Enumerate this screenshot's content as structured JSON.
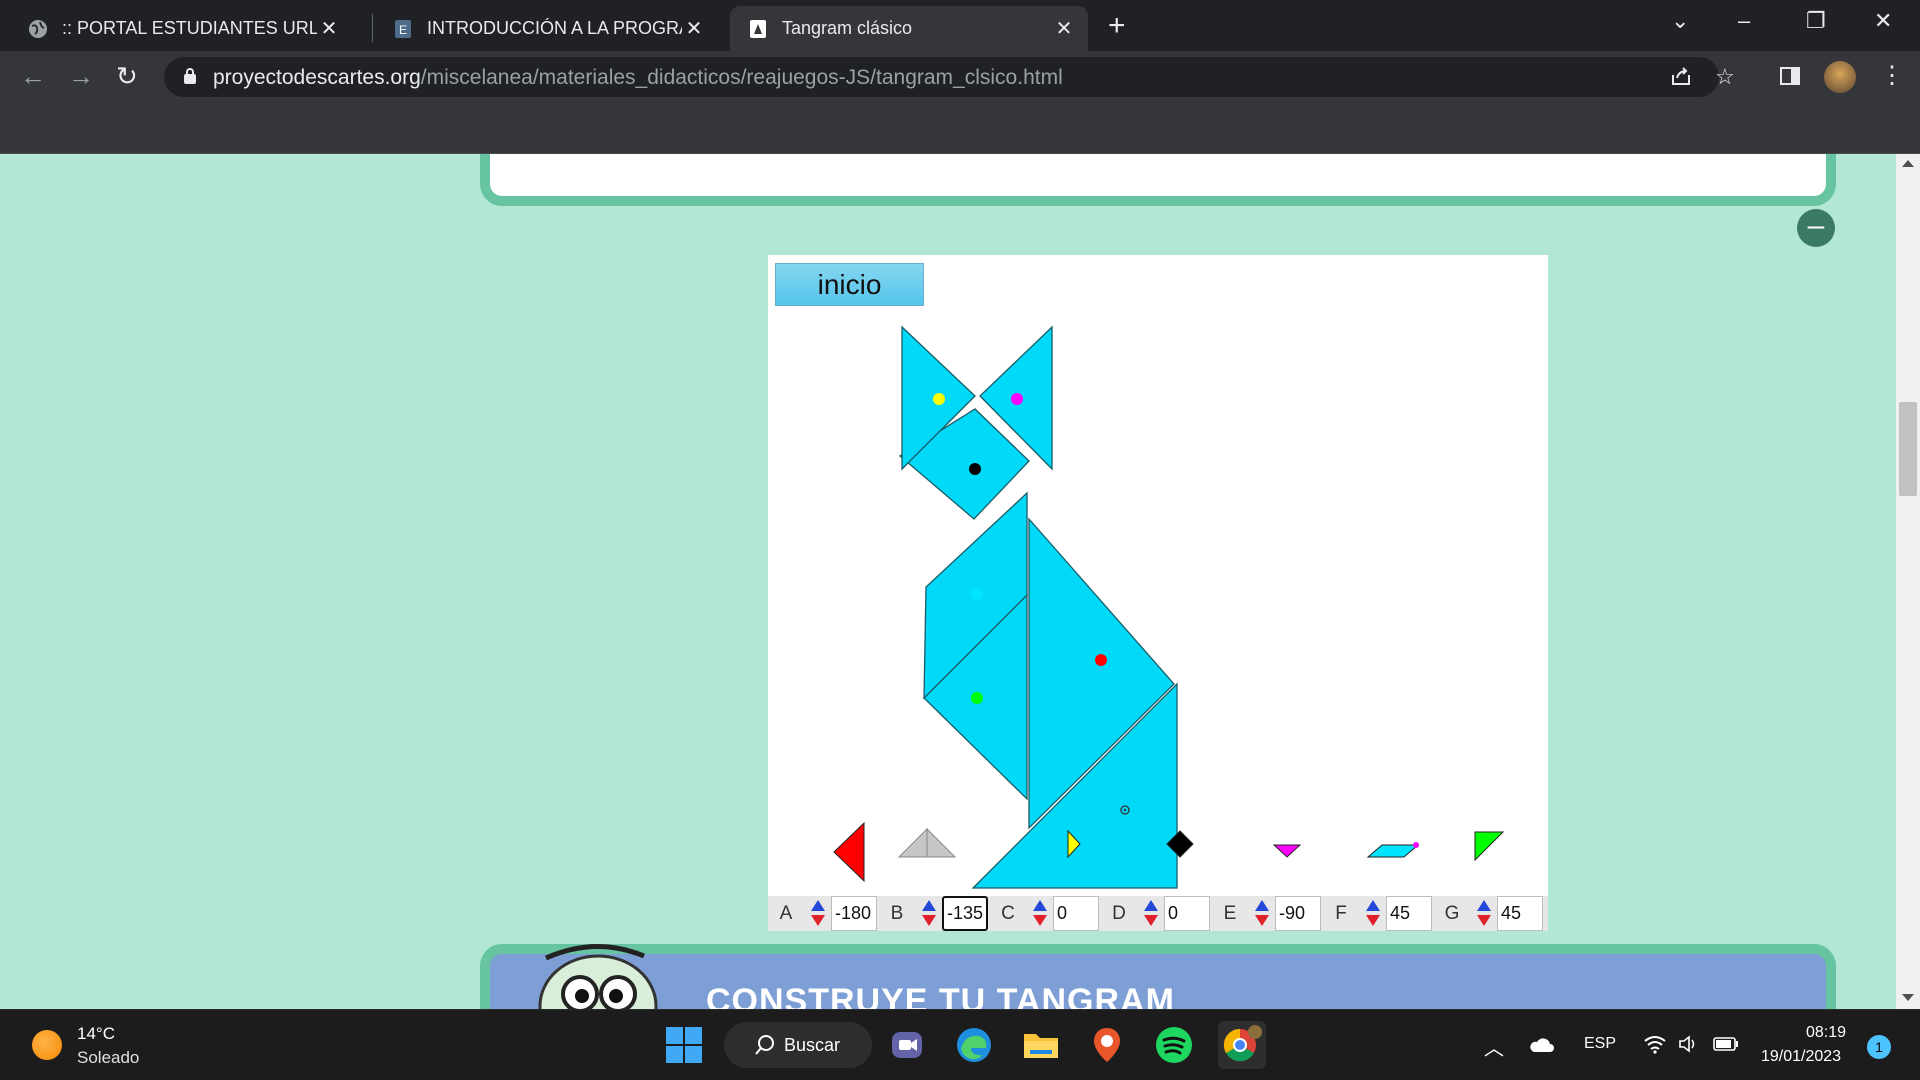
{
  "browser": {
    "tabs": [
      {
        "title": ":: PORTAL ESTUDIANTES URL ::",
        "active": false
      },
      {
        "title": "INTRODUCCIÓN A LA PROGRAMACIÓN",
        "active": false
      },
      {
        "title": "Tangram clásico",
        "active": true
      }
    ],
    "new_tab_label": "+",
    "url_host": "proyectodescartes.org",
    "url_path": "/miscelanea/materiales_didacticos/reajuegos-JS/tangram_clsico.html"
  },
  "scene": {
    "start_button": "inicio",
    "controls": [
      {
        "label": "A",
        "value": "-180"
      },
      {
        "label": "B",
        "value": "-135"
      },
      {
        "label": "C",
        "value": "0"
      },
      {
        "label": "D",
        "value": "0"
      },
      {
        "label": "E",
        "value": "-90"
      },
      {
        "label": "F",
        "value": "45"
      },
      {
        "label": "G",
        "value": "45"
      }
    ],
    "colors": {
      "piece_fill": "#00d9f7",
      "piece_stroke": "#1a5b68",
      "A": "#ff0000",
      "B": "#c6c6c6",
      "C": "#ffff00",
      "D": "#000000",
      "E": "#ff00ff",
      "F": "#00e5ff",
      "G": "#00ff00"
    }
  },
  "next_section": {
    "title": "CONSTRUYE TU TANGRAM"
  },
  "taskbar": {
    "weather_temp": "14°C",
    "weather_desc": "Soleado",
    "search_label": "Buscar",
    "language": "ESP",
    "time": "08:19",
    "date": "19/01/2023",
    "notifications": "1"
  }
}
